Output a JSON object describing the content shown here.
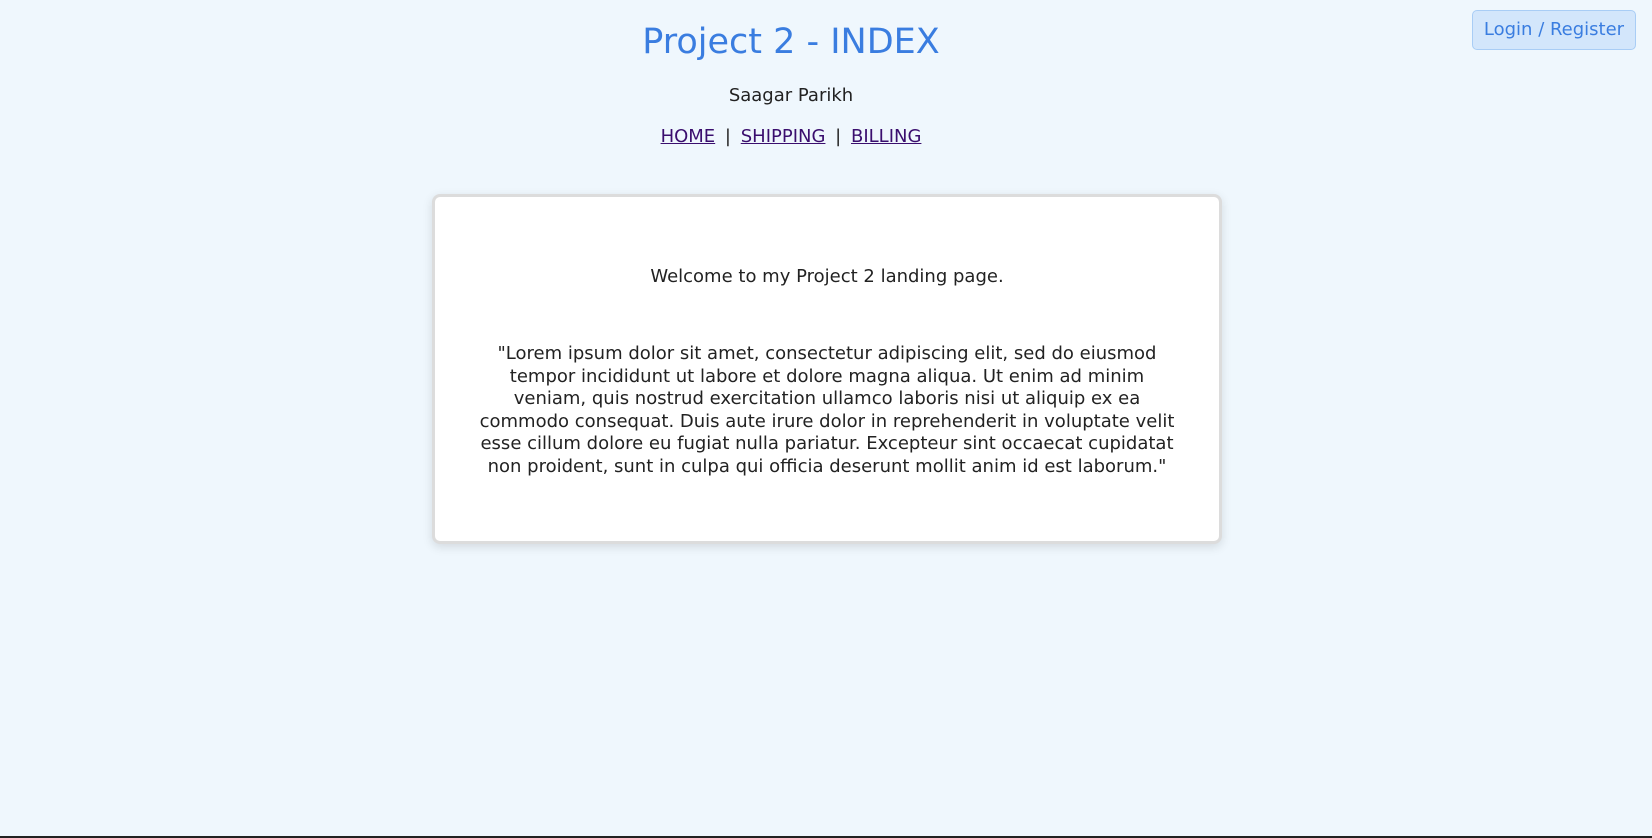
{
  "header": {
    "title": "Project 2 - INDEX",
    "author": "Saagar Parikh",
    "login_label": "Login / Register"
  },
  "nav": {
    "items": [
      {
        "label": "HOME"
      },
      {
        "label": "SHIPPING"
      },
      {
        "label": "BILLING"
      }
    ],
    "separator": "|"
  },
  "card": {
    "welcome": "Welcome to my Project 2 landing page.",
    "quote": "\"Lorem ipsum dolor sit amet, consectetur adipiscing elit, sed do eiusmod tempor incididunt ut labore et dolore magna aliqua. Ut enim ad minim veniam, quis nostrud exercitation ullamco laboris nisi ut aliquip ex ea commodo consequat. Duis aute irure dolor in reprehenderit in voluptate velit esse cillum dolore eu fugiat nulla pariatur. Excepteur sint occaecat cupidatat non proident, sunt in culpa qui officia deserunt mollit anim id est laborum.\""
  },
  "colors": {
    "background": "#eff7fd",
    "accent": "#3a7de0",
    "link": "#3a0e6e"
  }
}
